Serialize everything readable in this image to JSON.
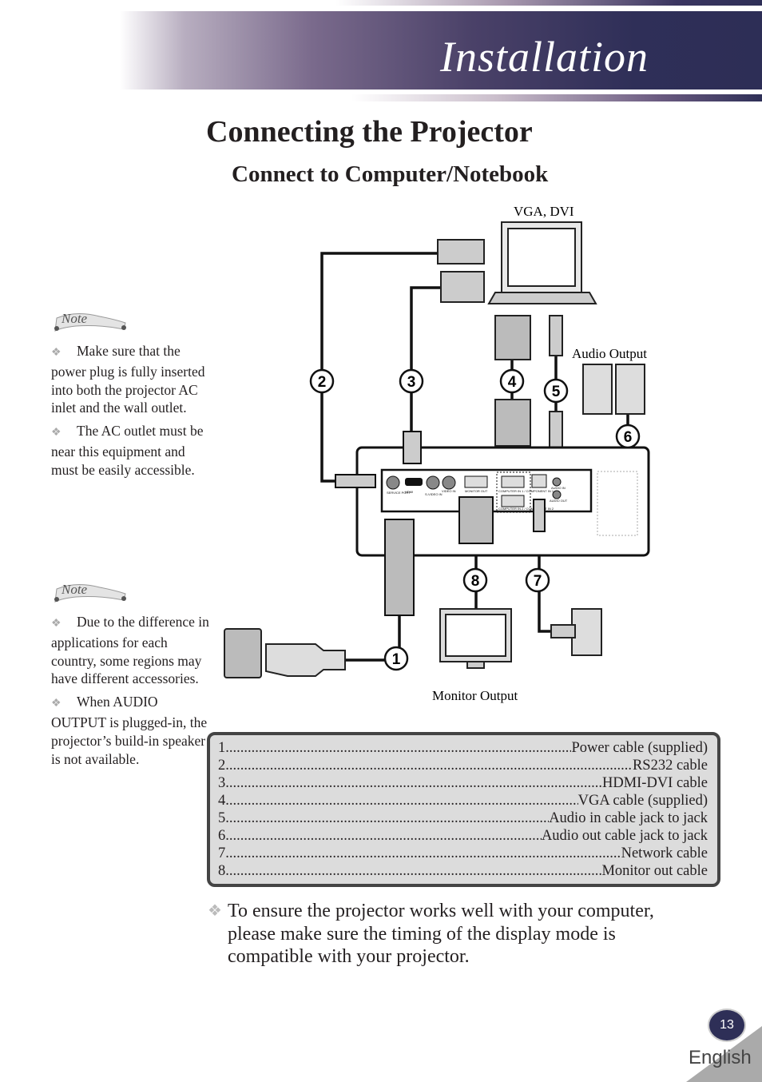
{
  "header": {
    "section": "Installation"
  },
  "title": "Connecting the Projector",
  "subtitle": "Connect to Computer/Notebook",
  "notes": [
    {
      "head": "Note",
      "items": [
        "Make sure that the power plug is fully inserted into both the projector AC inlet and the wall outlet.",
        "The AC outlet must be near this equipment and must be easily accessible."
      ]
    },
    {
      "head": "Note",
      "items": [
        "Due to the difference in applications for each country, some regions may have different accessories.",
        "When AUDIO OUTPUT is plugged-in, the projector’s build-in speaker is not available."
      ]
    }
  ],
  "diagram": {
    "labels": {
      "vga_dvi": "VGA, DVI",
      "audio_output": "Audio Output",
      "monitor_output": "Monitor Output"
    },
    "callouts": [
      "1",
      "2",
      "3",
      "4",
      "5",
      "6",
      "7",
      "8"
    ],
    "panel": {
      "service": "SERVICE PORT",
      "hdmi": "HDMI",
      "svideo": "S-VIDEO IN",
      "video": "VIDEO IN",
      "monitor_out": "MONITOR OUT",
      "comp1": "COMPUTER IN 1 / COMPONENT IN 1",
      "comp2": "COMPUTER IN 2 / COMPONENT IN 2",
      "audio_in": "AUDIO IN",
      "audio_out": "AUDIO OUT"
    }
  },
  "cables": [
    {
      "num": "1",
      "name": "Power cable (supplied)"
    },
    {
      "num": "2",
      "name": "RS232 cable"
    },
    {
      "num": "3",
      "name": "HDMI-DVI cable"
    },
    {
      "num": "4",
      "name": "VGA cable (supplied)"
    },
    {
      "num": "5",
      "name": "Audio in cable jack to jack"
    },
    {
      "num": "6",
      "name": "Audio out cable jack to jack"
    },
    {
      "num": "7",
      "name": "Network cable"
    },
    {
      "num": "8",
      "name": "Monitor out cable"
    }
  ],
  "tip": "To ensure the projector works well with your computer, please make sure the timing of the display mode is compatible with your projector.",
  "footer": {
    "page": "13",
    "language": "English"
  },
  "colors": {
    "banner": "#2e2f57",
    "table_bg": "#dcdcdc"
  }
}
